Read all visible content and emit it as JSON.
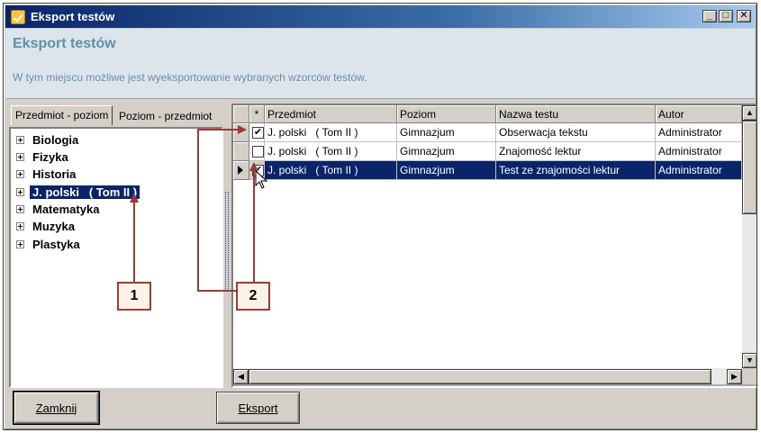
{
  "window": {
    "title": "Eksport testów",
    "controls": {
      "minimize": "_",
      "maximize": "□",
      "close": "✕"
    }
  },
  "header": {
    "title": "Eksport testów",
    "description": "W tym miejscu możliwe jest wyeksportowanie wybranych wzorców testów."
  },
  "left_panel": {
    "tabs": [
      "Przedmiot - poziom",
      "Poziom - przedmiot"
    ],
    "active_tab": 0,
    "tree": [
      {
        "label": "Biologia",
        "selected": false
      },
      {
        "label": "Fizyka",
        "selected": false
      },
      {
        "label": "Historia",
        "selected": false
      },
      {
        "label": "J. polski   ( Tom II )",
        "selected": true
      },
      {
        "label": "Matematyka",
        "selected": false
      },
      {
        "label": "Muzyka",
        "selected": false
      },
      {
        "label": "Plastyka",
        "selected": false
      }
    ]
  },
  "grid": {
    "columns": {
      "check": "*",
      "subject": "Przedmiot",
      "level": "Poziom",
      "name": "Nazwa testu",
      "author": "Autor"
    },
    "rows": [
      {
        "checked": true,
        "current": false,
        "selected": false,
        "subject": "J. polski   ( Tom II )",
        "level": "Gimnazjum",
        "name": "Obserwacja tekstu",
        "author": "Administrator"
      },
      {
        "checked": false,
        "current": false,
        "selected": false,
        "subject": "J. polski   ( Tom II )",
        "level": "Gimnazjum",
        "name": "Znajomość lektur",
        "author": "Administrator"
      },
      {
        "checked": true,
        "current": true,
        "selected": true,
        "subject": "J. polski   ( Tom II )",
        "level": "Gimnazjum",
        "name": "Test ze znajomości lektur",
        "author": "Administrator"
      }
    ],
    "check_mark": "✔",
    "scroll_glyphs": {
      "up": "▲",
      "down": "▼",
      "left": "◀",
      "right": "▶"
    }
  },
  "buttons": {
    "close": "Zamknij",
    "export": "Eksport"
  },
  "callouts": [
    "1",
    "2"
  ],
  "colors": {
    "selection": "#0a246a",
    "callout_border": "#9b3b38",
    "callout_fill": "#fdf3e7",
    "header_title": "#5f8fa8"
  }
}
